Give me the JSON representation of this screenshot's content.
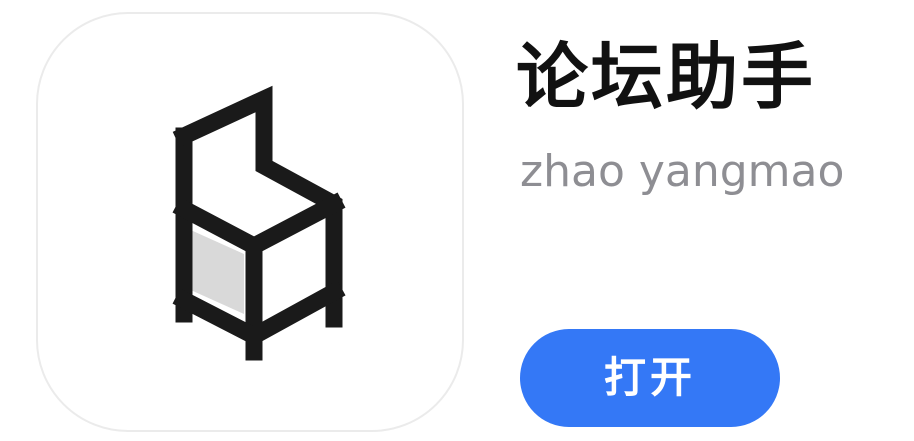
{
  "app": {
    "name": "论坛助手",
    "developer": "zhao yangmao",
    "open_label": "打开",
    "icon": "chair-icon"
  },
  "colors": {
    "button_bg": "#3478f6",
    "button_text": "#ffffff",
    "title_text": "#111111",
    "subtitle_text": "#8e8e93",
    "icon_stroke": "#1a1a1a",
    "icon_seat": "#d9d9d9"
  }
}
